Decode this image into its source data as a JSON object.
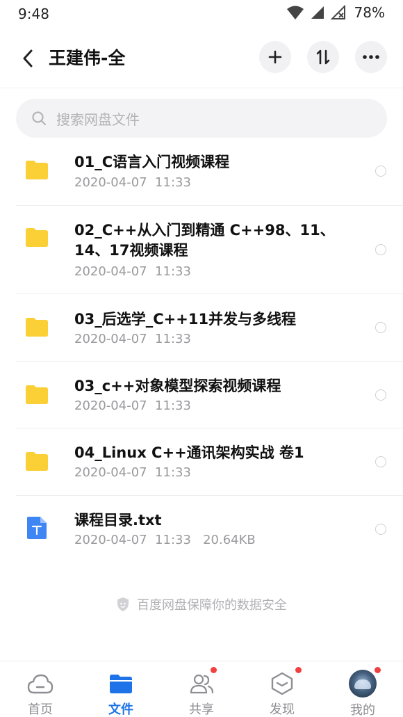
{
  "status_bar": {
    "time": "9:48",
    "battery": "78%"
  },
  "header": {
    "title": "王建伟-全",
    "back_icon": "chevron-left-icon",
    "add_icon": "plus-icon",
    "sort_icon": "sort-icon",
    "more_icon": "more-icon"
  },
  "search": {
    "placeholder": "搜索网盘文件"
  },
  "files": [
    {
      "name": "01_C语言入门视频课程",
      "date": "2020-04-07  11:33",
      "type": "folder"
    },
    {
      "name": "02_C++从入门到精通 C++98、11、14、17视频课程",
      "date": "2020-04-07  11:33",
      "type": "folder"
    },
    {
      "name": "03_后选学_C++11并发与多线程",
      "date": "2020-04-07  11:33",
      "type": "folder"
    },
    {
      "name": "03_c++对象模型探索视频课程",
      "date": "2020-04-07  11:33",
      "type": "folder"
    },
    {
      "name": "04_Linux C++通讯架构实战 卷1",
      "date": "2020-04-07  11:33",
      "type": "folder"
    },
    {
      "name": "课程目录.txt",
      "date": "2020-04-07  11:33   20.64KB",
      "type": "txt"
    }
  ],
  "security_note": "百度网盘保障你的数据安全",
  "tabs": [
    {
      "label": "首页",
      "icon": "cloud-icon",
      "active": false,
      "badge": false
    },
    {
      "label": "文件",
      "icon": "folder-icon",
      "active": true,
      "badge": false
    },
    {
      "label": "共享",
      "icon": "people-icon",
      "active": false,
      "badge": true
    },
    {
      "label": "发现",
      "icon": "cube-icon",
      "active": false,
      "badge": true
    },
    {
      "label": "我的",
      "icon": "avatar",
      "active": false,
      "badge": true
    }
  ],
  "colors": {
    "accent": "#1e73e8",
    "folder": "#fbcf36",
    "badge": "#f04040",
    "meta_text": "#9a9a9e"
  }
}
